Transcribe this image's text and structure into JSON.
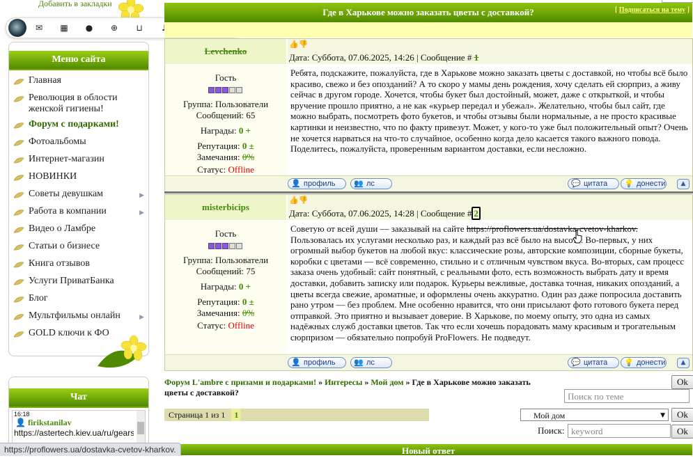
{
  "bookmark": "Добавить в закладки",
  "menu": {
    "title": "Меню сайта",
    "items": [
      {
        "label": "Главная",
        "active": false,
        "sub": false
      },
      {
        "label": "Революция в облости женской гигиены!",
        "active": false,
        "sub": false
      },
      {
        "label": "Форум с подарками!",
        "active": true,
        "sub": false
      },
      {
        "label": "Фотоальбомы",
        "active": false,
        "sub": false
      },
      {
        "label": "Интернет-магазин",
        "active": false,
        "sub": false
      },
      {
        "label": "НОВИНКИ",
        "active": false,
        "sub": false
      },
      {
        "label": "Советы девушкам",
        "active": false,
        "sub": true
      },
      {
        "label": "Работа в компании",
        "active": false,
        "sub": true
      },
      {
        "label": "Видео о Ламбре",
        "active": false,
        "sub": false
      },
      {
        "label": "Статьи о бизнесе",
        "active": false,
        "sub": false
      },
      {
        "label": "Книга отзывов",
        "active": false,
        "sub": false
      },
      {
        "label": "Услуги ПриватБанка",
        "active": false,
        "sub": false
      },
      {
        "label": "Блог",
        "active": false,
        "sub": false
      },
      {
        "label": "Мультфильмы онлайн",
        "active": false,
        "sub": true
      },
      {
        "label": "GOLD ключи к ФО",
        "active": false,
        "sub": false
      }
    ]
  },
  "chat": {
    "title": "Чат",
    "time": "16:18",
    "user": "firikstanilav",
    "message": "https://astertech.kiev.ua/ru/gears"
  },
  "topic": {
    "title": "Где в Харькове можно заказать цветы с доставкой?",
    "subscribe": "Подписаться на тему"
  },
  "labels": {
    "group": "Группа: Пользователи",
    "messages_prefix": "Сообщений:",
    "awards": "Награды:",
    "reputation": "Репутация:",
    "warnings": "Замечания:",
    "status": "Статус:",
    "profile": "профиль",
    "pm": "лс",
    "quote": "цитата",
    "report": "донести"
  },
  "posts": [
    {
      "author": "Levchenko",
      "rank": "Гость",
      "rank_level": 3,
      "messages": "65",
      "awards": "0",
      "reputation": "0",
      "warnings": "0%",
      "status": "Offline",
      "date": "Дата: Суббота, 07.06.2025, 14:26 | Сообщение #",
      "number": "1",
      "text": "Ребята, подскажите, пожалуйста, где в Харькове можно заказать цветы с доставкой, но чтобы всё было красиво, свежо и без опозданий? А то скоро у мамы день рождения, хочу сделать ей сюрприз, а живу сейчас в другом городе. Хочется, чтобы букет был достойный, может, даже с открыткой, и чтобы вручение прошло приятно, а не как «курьер передал и убежал». Желательно, чтобы был сайт, где можно выбрать, посмотреть фото букетов, и чтобы отзывы были нормальные, а не просто красивые картинки и неизвестно, что по факту привезут. Может, у кого-то уже был положительный опыт? Очень не хочется нарваться на что-то случайное, особенно когда дело касается такого важного повода. Поделитесь, пожалуйста, проверенным вариантом доставки, если несложно."
    },
    {
      "author": "misterbicips",
      "rank": "Гость",
      "rank_level": 3,
      "messages": "75",
      "awards": "0",
      "reputation": "0",
      "warnings": "0%",
      "status": "Offline",
      "date": "Дата: Суббота, 07.06.2025, 14:28 | Сообщение #",
      "number": "2",
      "text_before": "Советую от всей души — заказывай на сайте ",
      "link": "https://proflowers.ua/dostavka-cvetov-kharkov.",
      "text_after": " Пользовалась их услугами несколько раз, и каждый раз всё было на высоте. Во-первых, у них огромный выбор букетов на любой вкус: классические розы, авторские композиции, сборные букеты, коробки с цветами — всё современно, стильно и с отличным чувством вкуса. Во-вторых, сам процесс заказа очень удобный: сайт понятный, с реальными фото, есть возможность выбрать дату и время доставки, добавить записку или подарок. Курьеры вежливые, доставка точная, никаких опозданий, а цветы всегда свежие, ароматные, и оформлены очень аккуратно. Один раз даже попросила доставить рано утром — без проблем. Мне особенно нравится, что они присылают фото готового букета перед отправкой. Это приятно и вызывает доверие. В Харькове, по моему опыту, это одна из самых надёжных служб доставки цветов. Так что если хочешь порадовать маму красивым и трогательным сюрпризом — обязательно попробуй ProFlowers. Не подведут."
    }
  ],
  "breadcrumb": {
    "forum": "Форум L'ambre с призами и подарками!",
    "sep": " » ",
    "section": "Интересы",
    "sub": "Мой дом",
    "current": "Где в Харькове можно заказать цветы с доставкой?"
  },
  "pager": {
    "text": "Страница 1 из 1",
    "current": "1"
  },
  "controls": {
    "ok": "Ok",
    "topic_search_placeholder": "Поиск по теме",
    "jump_select": "Мой дом",
    "search_label": "Поиск:",
    "keyword_placeholder": "keyword"
  },
  "status_url": "https://proflowers.ua/dostavka-cvetov-kharkov.",
  "new_reply": "Новый ответ"
}
